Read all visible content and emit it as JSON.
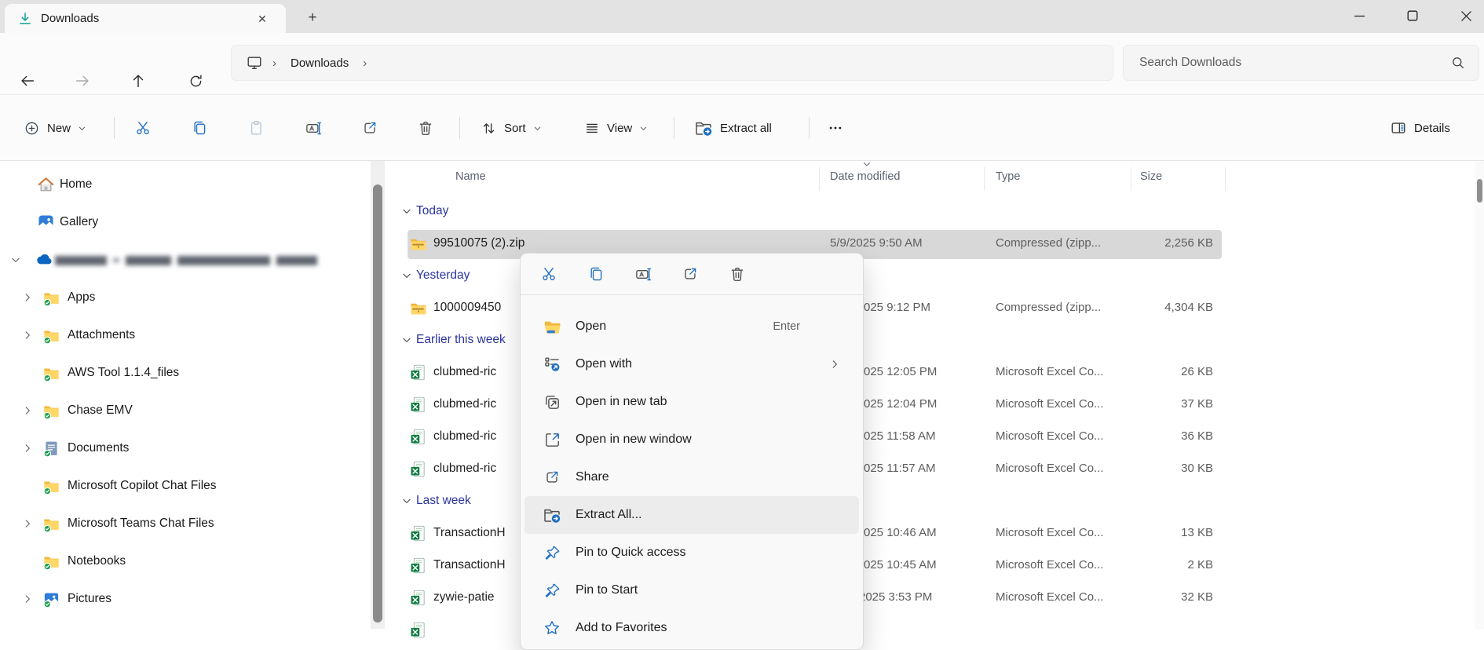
{
  "tab": {
    "title": "Downloads"
  },
  "nav": {
    "breadcrumb": {
      "root_icon": "monitor",
      "items": [
        "Downloads"
      ]
    },
    "search": {
      "placeholder": "Search Downloads"
    }
  },
  "toolbar": {
    "new_label": "New",
    "sort_label": "Sort",
    "view_label": "View",
    "extract_all_label": "Extract all",
    "details_label": "Details",
    "icon_buttons": [
      "cut",
      "copy",
      "paste",
      "rename",
      "share",
      "delete"
    ],
    "paste_disabled": true
  },
  "colors": {
    "accent_blue": "#1f6ec2",
    "group_header": "#2b34a0",
    "selection": "#d8d8d8"
  },
  "sidebar": {
    "items": [
      {
        "label": "Home",
        "icon": "home",
        "indent": 0,
        "chevron": "none"
      },
      {
        "label": "Gallery",
        "icon": "gallery",
        "indent": 0,
        "chevron": "none"
      },
      {
        "label": "",
        "redacted": true,
        "icon": "onedrive",
        "indent": 0,
        "chevron": "expanded"
      },
      {
        "label": "Apps",
        "icon": "folder-sync",
        "indent": 1,
        "chevron": "collapsed"
      },
      {
        "label": "Attachments",
        "icon": "folder-sync",
        "indent": 1,
        "chevron": "collapsed"
      },
      {
        "label": "AWS Tool 1.1.4_files",
        "icon": "folder-sync",
        "indent": 1,
        "chevron": "none"
      },
      {
        "label": "Chase EMV",
        "icon": "folder-sync",
        "indent": 1,
        "chevron": "collapsed"
      },
      {
        "label": "Documents",
        "icon": "documents-sync",
        "indent": 1,
        "chevron": "collapsed"
      },
      {
        "label": "Microsoft Copilot Chat Files",
        "icon": "folder-sync",
        "indent": 1,
        "chevron": "none"
      },
      {
        "label": "Microsoft Teams Chat Files",
        "icon": "folder-sync",
        "indent": 1,
        "chevron": "collapsed"
      },
      {
        "label": "Notebooks",
        "icon": "folder-sync",
        "indent": 1,
        "chevron": "none"
      },
      {
        "label": "Pictures",
        "icon": "pictures-sync",
        "indent": 1,
        "chevron": "collapsed"
      }
    ]
  },
  "list": {
    "columns": [
      "Name",
      "Date modified",
      "Type",
      "Size"
    ],
    "sorted_by": "Date modified",
    "rows": [
      {
        "kind": "group",
        "label": "Today"
      },
      {
        "kind": "file",
        "icon": "zip",
        "name": "99510075 (2).zip",
        "date": "5/9/2025 9:50 AM",
        "type": "Compressed (zipp...",
        "size": "2,256 KB",
        "selected": true
      },
      {
        "kind": "group",
        "label": "Yesterday"
      },
      {
        "kind": "file",
        "icon": "zip",
        "name": "1000009450",
        "date": "025 9:12 PM",
        "type": "Compressed (zipp...",
        "size": "4,304 KB"
      },
      {
        "kind": "group",
        "label": "Earlier this week"
      },
      {
        "kind": "file",
        "icon": "excel",
        "name": "clubmed-ric",
        "date": "025 12:05 PM",
        "type": "Microsoft Excel Co...",
        "size": "26 KB"
      },
      {
        "kind": "file",
        "icon": "excel",
        "name": "clubmed-ric",
        "date": "025 12:04 PM",
        "type": "Microsoft Excel Co...",
        "size": "37 KB"
      },
      {
        "kind": "file",
        "icon": "excel",
        "name": "clubmed-ric",
        "date": "025 11:58 AM",
        "type": "Microsoft Excel Co...",
        "size": "36 KB"
      },
      {
        "kind": "file",
        "icon": "excel",
        "name": "clubmed-ric",
        "date": "025 11:57 AM",
        "type": "Microsoft Excel Co...",
        "size": "30 KB"
      },
      {
        "kind": "group",
        "label": "Last week"
      },
      {
        "kind": "file",
        "icon": "excel",
        "name": "TransactionH",
        "date": "025 10:46 AM",
        "type": "Microsoft Excel Co...",
        "size": "13 KB"
      },
      {
        "kind": "file",
        "icon": "excel",
        "name": "TransactionH",
        "date": "025 10:45 AM",
        "type": "Microsoft Excel Co...",
        "size": "2 KB"
      },
      {
        "kind": "file",
        "icon": "excel",
        "name": "zywie-patie",
        "date": "2025 3:53 PM",
        "type": "Microsoft Excel Co...",
        "size": "32 KB"
      },
      {
        "kind": "file",
        "icon": "excel",
        "name": "",
        "date": "",
        "type": "",
        "size": ""
      }
    ]
  },
  "context_menu": {
    "quick_actions": [
      "cut",
      "copy",
      "rename",
      "share",
      "delete"
    ],
    "items": [
      {
        "label": "Open",
        "icon": "open-folder",
        "shortcut": "Enter"
      },
      {
        "label": "Open with",
        "icon": "open-with",
        "submenu": true
      },
      {
        "label": "Open in new tab",
        "icon": "open-new-tab"
      },
      {
        "label": "Open in new window",
        "icon": "open-new-window"
      },
      {
        "label": "Share",
        "icon": "share",
        "blue": true
      },
      {
        "label": "Extract All...",
        "icon": "extract",
        "highlighted": true
      },
      {
        "label": "Pin to Quick access",
        "icon": "pin"
      },
      {
        "label": "Pin to Start",
        "icon": "pin"
      },
      {
        "label": "Add to Favorites",
        "icon": "star"
      }
    ]
  }
}
